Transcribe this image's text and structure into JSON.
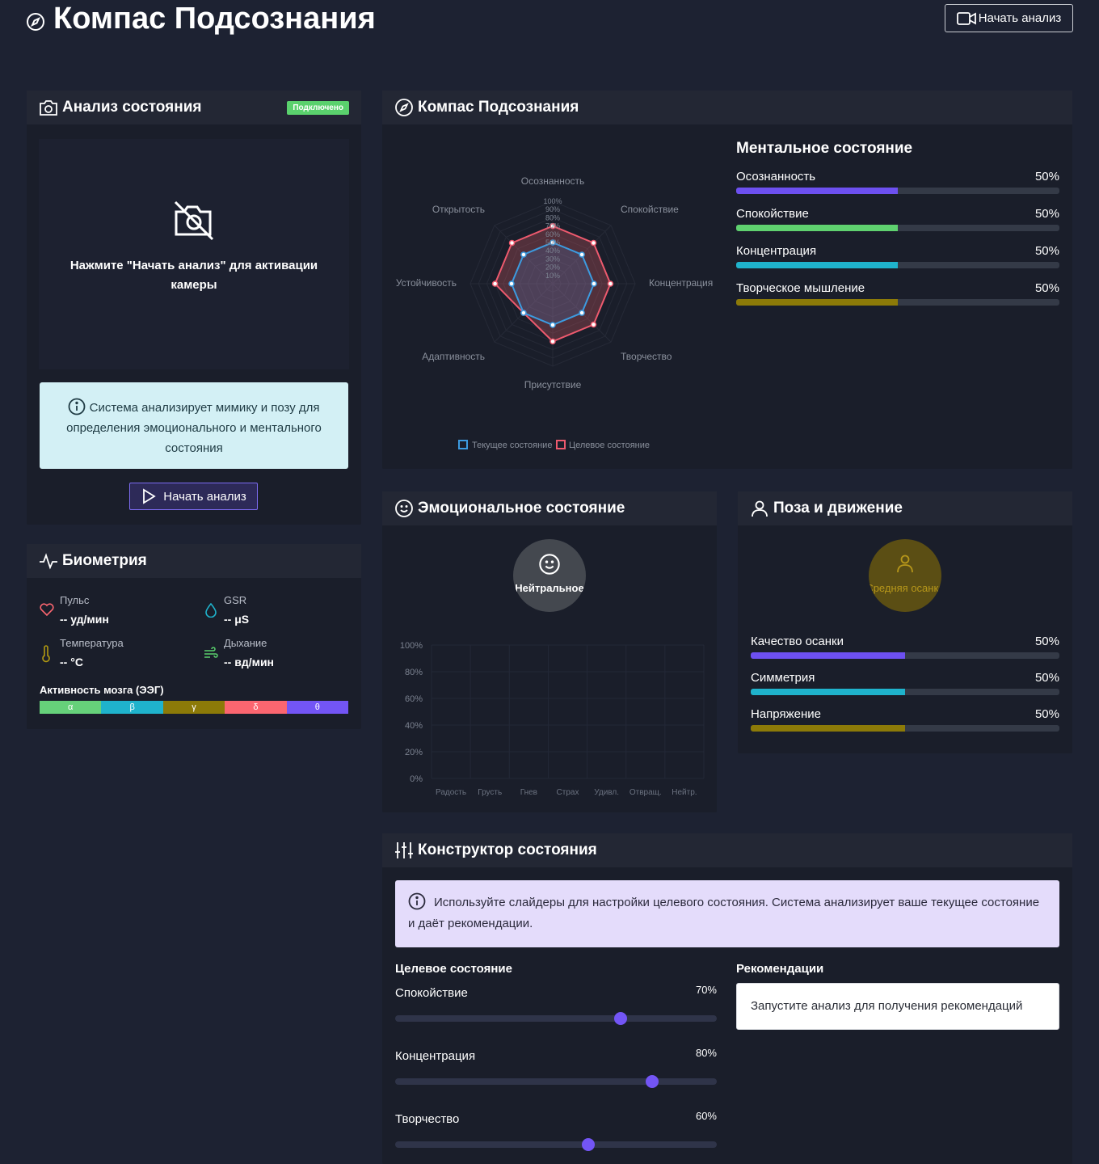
{
  "header": {
    "title": "Компас Подсознания",
    "start_button": "Начать анализ"
  },
  "camera": {
    "title": "Анализ состояния",
    "badge": "Подключено",
    "placeholder": "Нажмите \"Начать анализ\" для активации камеры",
    "info": "Система анализирует мимику и позу для определения эмоционального и ментального состояния",
    "start_button": "Начать анализ"
  },
  "biometrics": {
    "title": "Биометрия",
    "items": [
      {
        "label": "Пульс",
        "value": "-- уд/мин"
      },
      {
        "label": "GSR",
        "value": "-- μS"
      },
      {
        "label": "Температура",
        "value": "-- °C"
      },
      {
        "label": "Дыхание",
        "value": "-- вд/мин"
      }
    ],
    "eeg_title": "Активность мозга (ЭЭГ)",
    "eeg_bands": [
      {
        "label": "α",
        "color": "#66d17a"
      },
      {
        "label": "β",
        "color": "#1fb3cc"
      },
      {
        "label": "γ",
        "color": "#8c7a08"
      },
      {
        "label": "δ",
        "color": "#fb6670"
      },
      {
        "label": "θ",
        "color": "#7355f5"
      }
    ]
  },
  "compass": {
    "title": "Компас Подсознания",
    "mental_title": "Ментальное состояние",
    "mental": [
      {
        "label": "Осознанность",
        "value": "50%",
        "color": "#6d50f0"
      },
      {
        "label": "Спокойствие",
        "value": "50%",
        "color": "#5fd16f"
      },
      {
        "label": "Концентрация",
        "value": "50%",
        "color": "#1fb3cc"
      },
      {
        "label": "Творческое мышление",
        "value": "50%",
        "color": "#8c7a08"
      }
    ],
    "radar": {
      "axes": [
        "Осознанность",
        "Спокойствие",
        "Концентрация",
        "Творчество",
        "Присутствие",
        "Адаптивность",
        "Устойчивость",
        "Открытость"
      ],
      "ticks": [
        "100%",
        "90%",
        "80%",
        "70%",
        "60%",
        "50%",
        "40%",
        "30%",
        "20%",
        "10%"
      ],
      "current": [
        50,
        50,
        50,
        50,
        50,
        50,
        50,
        50
      ],
      "target": [
        70,
        70,
        70,
        70,
        70,
        50,
        70,
        70
      ],
      "legend_current": "Текущее состояние",
      "legend_target": "Целевое состояние"
    }
  },
  "emotion": {
    "title": "Эмоциональное состояние",
    "current": "Нейтральное",
    "y_ticks": [
      "100%",
      "80%",
      "60%",
      "40%",
      "20%",
      "0%"
    ],
    "categories": [
      "Радость",
      "Грусть",
      "Гнев",
      "Страх",
      "Удивл.",
      "Отвращ.",
      "Нейтр."
    ]
  },
  "posture": {
    "title": "Поза и движение",
    "current": "Средняя осанка",
    "metrics": [
      {
        "label": "Качество осанки",
        "value": "50%",
        "color": "#6d50f0"
      },
      {
        "label": "Симметрия",
        "value": "50%",
        "color": "#1fb3cc"
      },
      {
        "label": "Напряжение",
        "value": "50%",
        "color": "#8c7a08"
      }
    ]
  },
  "constructor": {
    "title": "Конструктор состояния",
    "info": "Используйте слайдеры для настройки целевого состояния. Система анализирует ваше текущее состояние и даёт рекомендации.",
    "target_title": "Целевое состояние",
    "sliders": [
      {
        "label": "Спокойствие",
        "value": "70%"
      },
      {
        "label": "Концентрация",
        "value": "80%"
      },
      {
        "label": "Творчество",
        "value": "60%"
      }
    ],
    "rec_title": "Рекомендации",
    "rec_text": "Запустите анализ для получения рекомендаций"
  }
}
